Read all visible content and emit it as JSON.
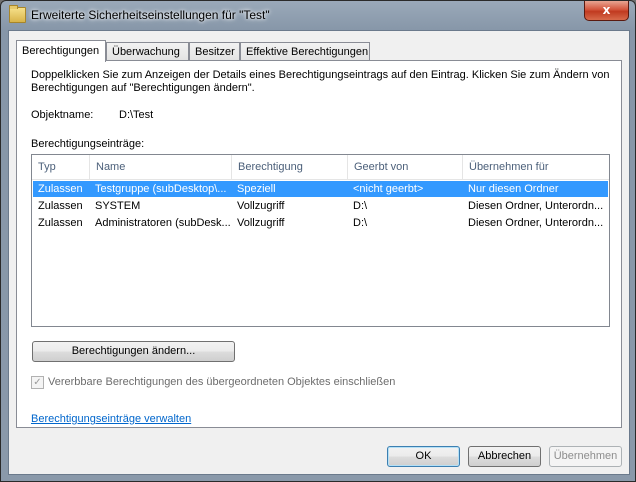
{
  "window": {
    "title": "Erweiterte Sicherheitseinstellungen für \"Test\"",
    "close_glyph": "x"
  },
  "tabs": [
    {
      "label": "Berechtigungen",
      "active": true
    },
    {
      "label": "Überwachung",
      "active": false
    },
    {
      "label": "Besitzer",
      "active": false
    },
    {
      "label": "Effektive Berechtigungen",
      "active": false
    }
  ],
  "panel": {
    "description": "Doppelklicken Sie zum Anzeigen der Details eines Berechtigungseintrags auf den Eintrag. Klicken Sie zum Ändern von Berechtigungen auf \"Berechtigungen ändern\".",
    "object_name_label": "Objektname:",
    "object_name_value": "D:\\Test",
    "entries_label": "Berechtigungseinträge:",
    "columns": [
      "Typ",
      "Name",
      "Berechtigung",
      "Geerbt von",
      "Übernehmen für"
    ],
    "rows": [
      {
        "typ": "Zulassen",
        "name": "Testgruppe (subDesktop\\...",
        "berechtigung": "Speziell",
        "geerbt": "<nicht geerbt>",
        "uebernehmen": "Nur diesen Ordner",
        "selected": true
      },
      {
        "typ": "Zulassen",
        "name": "SYSTEM",
        "berechtigung": "Vollzugriff",
        "geerbt": "D:\\",
        "uebernehmen": "Diesen Ordner, Unterordn...",
        "selected": false
      },
      {
        "typ": "Zulassen",
        "name": "Administratoren (subDesk...",
        "berechtigung": "Vollzugriff",
        "geerbt": "D:\\",
        "uebernehmen": "Diesen Ordner, Unterordn...",
        "selected": false
      }
    ],
    "change_button": "Berechtigungen ändern...",
    "inherit_checkbox": {
      "label": "Vererbbare Berechtigungen des übergeordneten Objektes einschließen",
      "checked": true,
      "enabled": false,
      "glyph": "✓"
    },
    "manage_link": "Berechtigungseinträge verwalten"
  },
  "footer": {
    "ok": "OK",
    "cancel": "Abbrechen",
    "apply": "Übernehmen"
  },
  "colors": {
    "selection": "#3399ff",
    "link": "#0066cc",
    "header_text": "#4c607a"
  }
}
